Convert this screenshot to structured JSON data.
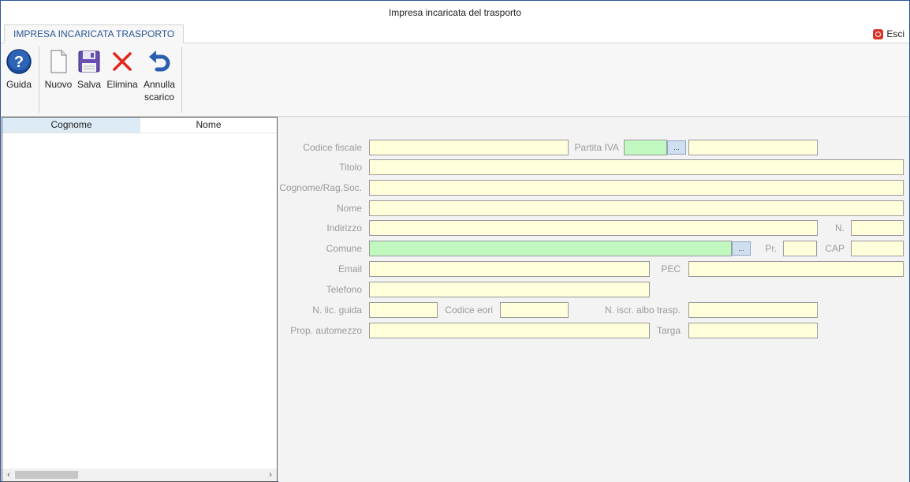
{
  "window": {
    "title": "Impresa incaricata del trasporto"
  },
  "tabs": [
    {
      "label": "IMPRESA INCARICATA TRASPORTO"
    }
  ],
  "exit": {
    "label": "Esci"
  },
  "ribbon": {
    "guida": "Guida",
    "nuovo": "Nuovo",
    "salva": "Salva",
    "elimina": "Elimina",
    "annulla_line1": "Annulla",
    "annulla_line2": "scarico"
  },
  "grid": {
    "columns": [
      "Cognome",
      "Nome"
    ],
    "rows": []
  },
  "form": {
    "codice_fiscale": {
      "label": "Codice fiscale",
      "value": ""
    },
    "partita_iva": {
      "label": "Partita IVA",
      "country": "",
      "value": ""
    },
    "titolo": {
      "label": "Titolo",
      "value": ""
    },
    "cognome": {
      "label": "Cognome/Rag.Soc.",
      "value": ""
    },
    "nome": {
      "label": "Nome",
      "value": ""
    },
    "indirizzo": {
      "label": "Indirizzo",
      "value": ""
    },
    "numero": {
      "label": "N.",
      "value": ""
    },
    "comune": {
      "label": "Comune",
      "value": ""
    },
    "provincia": {
      "label": "Pr.",
      "value": ""
    },
    "cap": {
      "label": "CAP",
      "value": ""
    },
    "email": {
      "label": "Email",
      "value": ""
    },
    "pec": {
      "label": "PEC",
      "value": ""
    },
    "telefono": {
      "label": "Telefono",
      "value": ""
    },
    "lic_guida": {
      "label": "N. lic. guida",
      "value": ""
    },
    "codice_eori": {
      "label": "Codice eori",
      "value": ""
    },
    "iscr_albo": {
      "label": "N. iscr. albo trasp.",
      "value": ""
    },
    "prop_automezzo": {
      "label": "Prop. automezzo",
      "value": ""
    },
    "targa": {
      "label": "Targa",
      "value": ""
    },
    "ellipsis": "..."
  },
  "colors": {
    "accent": "#2b5797",
    "field_yellow": "#ffffdc",
    "field_green": "#c0f8c0"
  }
}
